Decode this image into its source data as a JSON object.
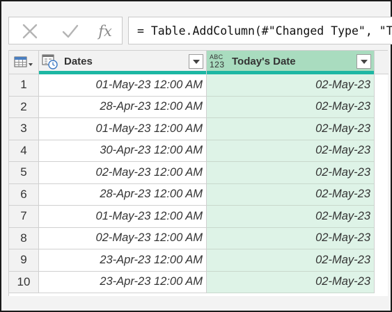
{
  "formula_bar": {
    "cancel_glyph": "✕",
    "accept_glyph": "✓",
    "fx_label": "fx",
    "formula": "= Table.AddColumn(#\"Changed Type\", \"T"
  },
  "table": {
    "columns": [
      {
        "name": "Dates",
        "type_icon": "date-time-type-icon"
      },
      {
        "name": "Today's Date",
        "type_icon": "any-type-icon",
        "type_top": "ABC",
        "type_bottom": "123"
      }
    ],
    "rows": [
      {
        "n": "1",
        "dates": "01-May-23 12:00 AM",
        "today": "02-May-23"
      },
      {
        "n": "2",
        "dates": "28-Apr-23 12:00 AM",
        "today": "02-May-23"
      },
      {
        "n": "3",
        "dates": "01-May-23 12:00 AM",
        "today": "02-May-23"
      },
      {
        "n": "4",
        "dates": "30-Apr-23 12:00 AM",
        "today": "02-May-23"
      },
      {
        "n": "5",
        "dates": "02-May-23 12:00 AM",
        "today": "02-May-23"
      },
      {
        "n": "6",
        "dates": "28-Apr-23 12:00 AM",
        "today": "02-May-23"
      },
      {
        "n": "7",
        "dates": "01-May-23 12:00 AM",
        "today": "02-May-23"
      },
      {
        "n": "8",
        "dates": "02-May-23 12:00 AM",
        "today": "02-May-23"
      },
      {
        "n": "9",
        "dates": "23-Apr-23 12:00 AM",
        "today": "02-May-23"
      },
      {
        "n": "10",
        "dates": "23-Apr-23 12:00 AM",
        "today": "02-May-23"
      }
    ]
  },
  "colors": {
    "selected_header": "#a9dcbf",
    "selected_cells": "#def3e7",
    "quality_bar": "#1db7a3"
  }
}
